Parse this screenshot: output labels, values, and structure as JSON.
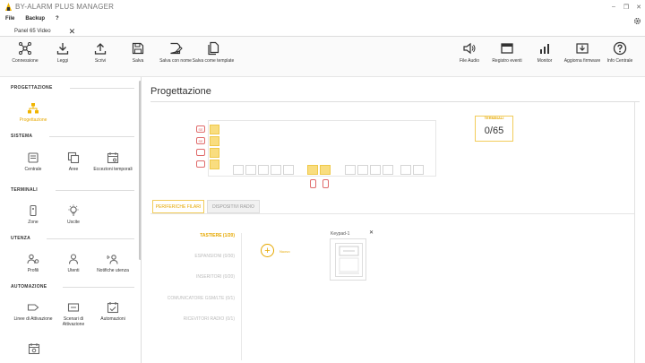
{
  "app": {
    "title": "BY-ALARM PLUS MANAGER"
  },
  "window_controls": [
    "–",
    "❐",
    "✕"
  ],
  "menu": [
    "File",
    "Backup",
    "?"
  ],
  "doc_tab": {
    "label": "Panel 65 Video",
    "close": "✕"
  },
  "toolbar": {
    "left": [
      {
        "label": "Connessione",
        "icon": "network-icon"
      },
      {
        "label": "Leggi",
        "icon": "download-icon"
      },
      {
        "label": "Scrivi",
        "icon": "upload-icon"
      },
      {
        "label": "Salva",
        "icon": "save-icon"
      },
      {
        "label": "Salva con nome",
        "icon": "save-as-icon"
      },
      {
        "label": "Salva come template",
        "icon": "template-icon"
      }
    ],
    "right": [
      {
        "label": "File Audio",
        "icon": "speaker-icon"
      },
      {
        "label": "Registro eventi",
        "icon": "event-log-icon"
      },
      {
        "label": "Monitor",
        "icon": "bar-chart-icon"
      },
      {
        "label": "Aggiorna firmware",
        "icon": "firmware-icon"
      },
      {
        "label": "Info Centrale",
        "icon": "help-icon"
      }
    ]
  },
  "sidebar": {
    "sections": [
      "PROGETTAZIONE",
      "SISTEMA",
      "TERMINALI",
      "UTENZA",
      "AUTOMAZIONE"
    ],
    "items": [
      {
        "label": "Progettazione",
        "icon": "sitemap-icon",
        "active": true
      },
      {
        "label": "Centrale",
        "icon": "panel-icon"
      },
      {
        "label": "Aree",
        "icon": "areas-icon"
      },
      {
        "label": "Eccezioni temporali",
        "icon": "calendar-icon"
      },
      {
        "label": "Zone",
        "icon": "zone-icon"
      },
      {
        "label": "Uscite",
        "icon": "bulb-icon"
      },
      {
        "label": "Profili",
        "icon": "profiles-icon"
      },
      {
        "label": "Utenti",
        "icon": "user-icon"
      },
      {
        "label": "Notifiche utenza",
        "icon": "notification-icon"
      },
      {
        "label": "Linee di Attivazione",
        "icon": "tag-icon"
      },
      {
        "label": "Scenari di Attivazione",
        "icon": "scenario-icon"
      },
      {
        "label": "Automazioni",
        "icon": "automation-icon"
      }
    ]
  },
  "main": {
    "title": "Progettazione",
    "board_labels": [
      "SE",
      "SE"
    ],
    "counter": {
      "label": "TERMINALI",
      "value": "0/65"
    },
    "subtabs": [
      "PERIFERICHE FILARI",
      "DISPOSITIVI RADIO"
    ],
    "categories": [
      {
        "label": "TASTIERE (1/20)",
        "active": true
      },
      {
        "label": "ESPANSIONI (0/30)"
      },
      {
        "label": "INSERITORI (0/20)"
      },
      {
        "label": "COMUNICATORE GSM/LTE (0/1)"
      },
      {
        "label": "RICEVITORI RADIO (0/1)"
      }
    ],
    "add_label": "Nuovo",
    "device": {
      "title": "Keypad-1",
      "close": "✕"
    }
  },
  "colors": {
    "accent": "#e6a800",
    "accent_fill": "#f9dd7f",
    "alarm_red": "#e06b6b"
  }
}
